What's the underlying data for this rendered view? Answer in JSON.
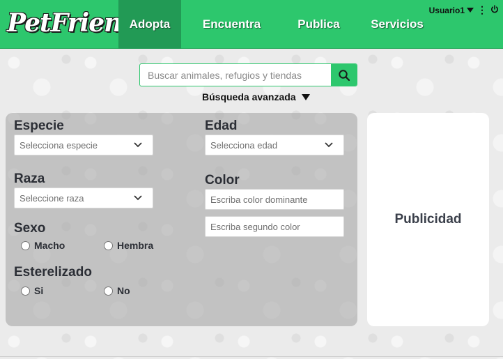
{
  "brand": {
    "logo": "PetFriend"
  },
  "nav": {
    "items": [
      {
        "label": "Adopta",
        "active": true
      },
      {
        "label": "Encuentra",
        "active": false
      },
      {
        "label": "Publica",
        "active": false
      },
      {
        "label": "Servicios",
        "active": false
      }
    ]
  },
  "user": {
    "name": "Usuario1",
    "icons": [
      "chevron-down-icon",
      "kebab-menu-icon",
      "power-icon"
    ]
  },
  "search": {
    "placeholder": "Buscar animales, refugios y tiendas",
    "value": "",
    "button_icon": "search-icon",
    "advanced_label": "Búsqueda avanzada"
  },
  "filters": {
    "especie": {
      "label": "Especie",
      "placeholder": "Selecciona especie"
    },
    "edad": {
      "label": "Edad",
      "placeholder": "Selecciona edad"
    },
    "raza": {
      "label": "Raza",
      "placeholder": "Seleccione raza"
    },
    "color": {
      "label": "Color",
      "primary_placeholder": "Escriba color dominante",
      "secondary_placeholder": "Escriba segundo color"
    },
    "sexo": {
      "label": "Sexo",
      "options": [
        "Macho",
        "Hembra"
      ]
    },
    "esterelizado": {
      "label": "Esterelizado",
      "options": [
        "Si",
        "No"
      ]
    }
  },
  "ad": {
    "label": "Publicidad"
  },
  "colors": {
    "brand_green": "#2dc76d",
    "active_nav": "#229a55",
    "panel_overlay": "#a0a0a0",
    "text_dark": "#2b2e35"
  }
}
